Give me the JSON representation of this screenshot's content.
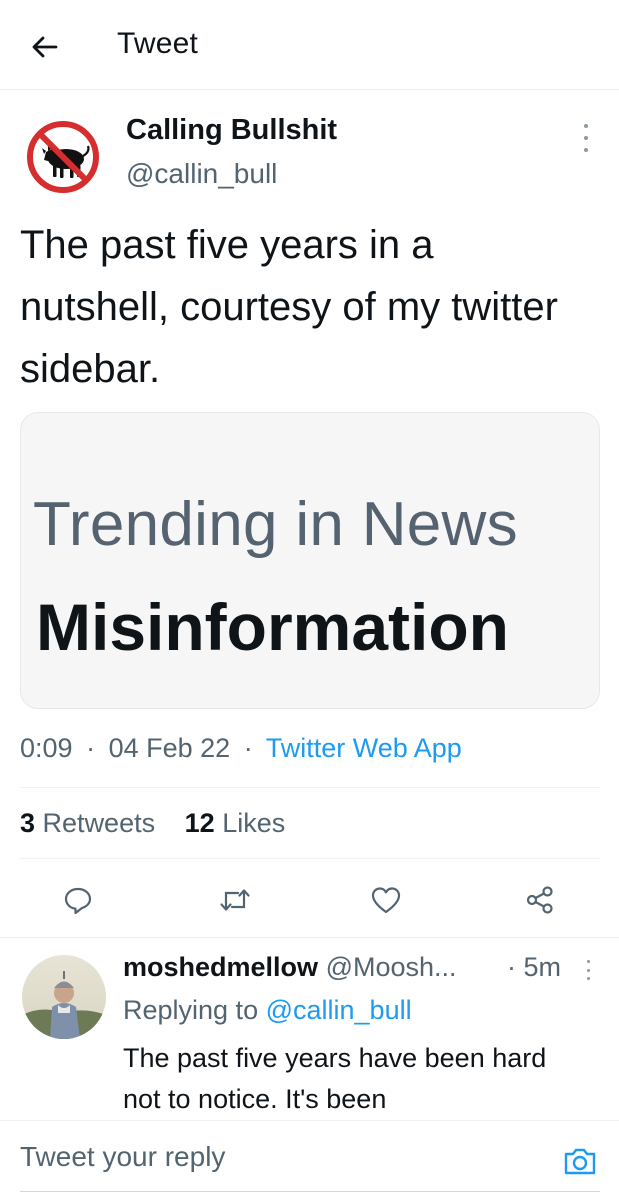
{
  "header": {
    "title": "Tweet",
    "back_icon": "arrow-left-icon"
  },
  "tweet": {
    "author_name": "Calling Bullshit",
    "author_handle": "@callin_bull",
    "text": "The past five years in a nutshell, courtesy of my twitter sidebar.",
    "media": {
      "headline": "Trending in News",
      "topic": "Misinformation"
    },
    "time": "0:09",
    "date": "04 Feb 22",
    "separator": "·",
    "source": "Twitter Web App",
    "retweets_count": "3",
    "retweets_label": "Retweets",
    "likes_count": "12",
    "likes_label": "Likes"
  },
  "actions": {
    "reply_icon": "reply-icon",
    "retweet_icon": "retweet-icon",
    "like_icon": "heart-icon",
    "share_icon": "share-icon"
  },
  "reply": {
    "name": "moshedmellow",
    "handle": "@Moosh...",
    "time": "· 5m",
    "replying_prefix": "Replying to",
    "replying_to": "@callin_bull",
    "text": "The past five years have been hard not to notice. It's been"
  },
  "composer": {
    "placeholder": "Tweet your reply",
    "camera_icon": "camera-icon"
  },
  "colors": {
    "accent": "#1d9bf0",
    "text_primary": "#0f1419",
    "text_secondary": "#536471",
    "media_bg": "#f6f6f6",
    "avatar_red": "#d62e2e"
  }
}
